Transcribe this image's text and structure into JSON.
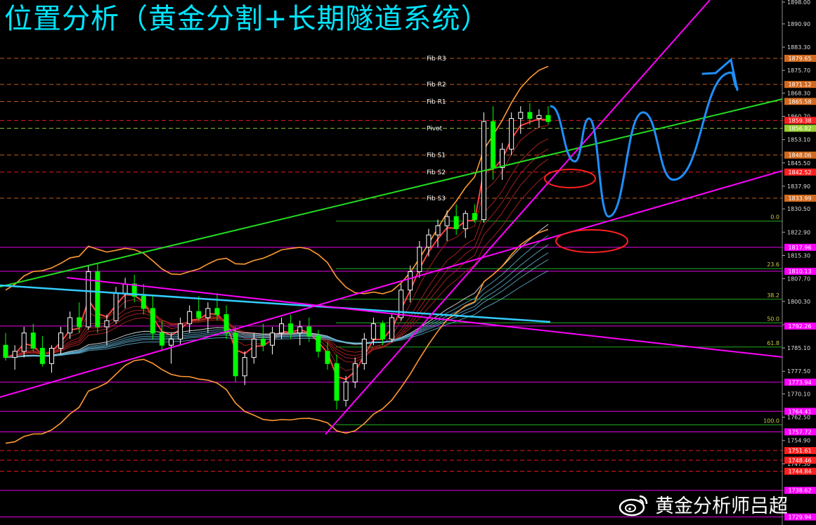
{
  "title": "位置分析（黄金分割+长期隧道系统）",
  "watermark": {
    "logo": "weibo-logo",
    "text": "黄金分析师吕超"
  },
  "colors": {
    "background": "#000000",
    "title": "#00e5ff",
    "magenta": "#ff00ff",
    "green_trend": "#22dd22",
    "cyan_trend": "#33ccff",
    "bollinger": "#ff9933",
    "blue_forecast": "#1e90ff",
    "red_ellipse": "#ff2020",
    "candle_up": "#ffffff",
    "candle_down": "#00ff00"
  },
  "chart_data": {
    "type": "candlestick",
    "instrument_hint": "gold",
    "ylim": [
      1728.0,
      1898.0
    ],
    "price_axis_ticks": [
      "1898.00",
      "1890.90",
      "1883.30",
      "1875.70",
      "1868.30",
      "1860.70",
      "1853.10",
      "1845.50",
      "1837.90",
      "1830.50",
      "1822.90",
      "1815.30",
      "1807.70",
      "1800.30",
      "1792.70",
      "1785.10",
      "1777.50",
      "1770.10",
      "1762.50",
      "1754.90",
      "1747.30"
    ],
    "level_tags": [
      {
        "value": 1879.65,
        "label": "1879.65",
        "color": "#d2691e"
      },
      {
        "value": 1871.12,
        "label": "1871.12",
        "color": "#d2691e"
      },
      {
        "value": 1865.58,
        "label": "1865.58",
        "color": "#d2691e"
      },
      {
        "value": 1859.38,
        "label": "1859.38",
        "color": "#ff2020"
      },
      {
        "value": 1856.82,
        "label": "1856.82",
        "color": "#9acd32"
      },
      {
        "value": 1848.06,
        "label": "1848.06",
        "color": "#d2691e"
      },
      {
        "value": 1842.52,
        "label": "1842.52",
        "color": "#ff2020"
      },
      {
        "value": 1833.99,
        "label": "1833.99",
        "color": "#d2691e"
      },
      {
        "value": 1817.96,
        "label": "1817.96",
        "color": "#ff00ff"
      },
      {
        "value": 1810.13,
        "label": "1810.13",
        "color": "#ff00ff"
      },
      {
        "value": 1792.26,
        "label": "1792.26",
        "color": "#ff00ff"
      },
      {
        "value": 1773.94,
        "label": "1773.94",
        "color": "#ff00ff"
      },
      {
        "value": 1764.41,
        "label": "1764.41",
        "color": "#ff00ff"
      },
      {
        "value": 1757.72,
        "label": "1757.72",
        "color": "#ff00ff"
      },
      {
        "value": 1751.61,
        "label": "1751.61",
        "color": "#ff2020"
      },
      {
        "value": 1748.46,
        "label": "1748.46",
        "color": "#ff2020"
      },
      {
        "value": 1744.84,
        "label": "1744.84",
        "color": "#ff2020"
      },
      {
        "value": 1738.62,
        "label": "1738.62",
        "color": "#ff00ff"
      },
      {
        "value": 1729.94,
        "label": "1729.94",
        "color": "#ff00ff"
      }
    ],
    "pivot_levels": [
      {
        "name": "Fib R3",
        "value": 1879.65
      },
      {
        "name": "Fib R2",
        "value": 1871.12
      },
      {
        "name": "Fib R1",
        "value": 1865.58
      },
      {
        "name": "Pivot",
        "value": 1856.82
      },
      {
        "name": "Fib S1",
        "value": 1848.06
      },
      {
        "name": "Fib S2",
        "value": 1842.52
      },
      {
        "name": "Fib S3",
        "value": 1833.99
      }
    ],
    "fib_retracement": [
      {
        "label": "0.0",
        "value": 1826.5
      },
      {
        "label": "23.6",
        "value": 1811.0
      },
      {
        "label": "38.2",
        "value": 1801.0
      },
      {
        "label": "50.0",
        "value": 1793.3
      },
      {
        "label": "61.8",
        "value": 1785.4
      },
      {
        "label": "100.0",
        "value": 1760.0
      }
    ],
    "ohlc": [
      [
        1786,
        1790,
        1781,
        1782
      ],
      [
        1782,
        1786,
        1778,
        1784
      ],
      [
        1784,
        1792,
        1782,
        1790
      ],
      [
        1790,
        1793,
        1784,
        1785
      ],
      [
        1785,
        1789,
        1779,
        1780
      ],
      [
        1780,
        1786,
        1777,
        1785
      ],
      [
        1785,
        1792,
        1783,
        1790
      ],
      [
        1790,
        1797,
        1788,
        1795
      ],
      [
        1795,
        1800,
        1790,
        1792
      ],
      [
        1792,
        1812,
        1791,
        1810
      ],
      [
        1810,
        1813,
        1790,
        1792
      ],
      [
        1792,
        1796,
        1786,
        1794
      ],
      [
        1794,
        1805,
        1793,
        1803
      ],
      [
        1803,
        1808,
        1798,
        1806
      ],
      [
        1806,
        1809,
        1800,
        1802
      ],
      [
        1802,
        1806,
        1796,
        1798
      ],
      [
        1798,
        1802,
        1788,
        1790
      ],
      [
        1790,
        1794,
        1784,
        1786
      ],
      [
        1786,
        1790,
        1780,
        1788
      ],
      [
        1788,
        1795,
        1786,
        1793
      ],
      [
        1793,
        1799,
        1790,
        1797
      ],
      [
        1797,
        1802,
        1794,
        1795
      ],
      [
        1795,
        1800,
        1790,
        1798
      ],
      [
        1798,
        1803,
        1794,
        1796
      ],
      [
        1796,
        1799,
        1788,
        1790
      ],
      [
        1790,
        1792,
        1774,
        1776
      ],
      [
        1776,
        1784,
        1773,
        1782
      ],
      [
        1782,
        1790,
        1780,
        1788
      ],
      [
        1788,
        1793,
        1784,
        1786
      ],
      [
        1786,
        1792,
        1783,
        1790
      ],
      [
        1790,
        1795,
        1788,
        1793
      ],
      [
        1793,
        1796,
        1788,
        1790
      ],
      [
        1790,
        1794,
        1786,
        1792
      ],
      [
        1792,
        1795,
        1787,
        1789
      ],
      [
        1789,
        1791,
        1782,
        1784
      ],
      [
        1784,
        1787,
        1778,
        1780
      ],
      [
        1780,
        1783,
        1765,
        1768
      ],
      [
        1768,
        1776,
        1766,
        1774
      ],
      [
        1774,
        1782,
        1772,
        1780
      ],
      [
        1780,
        1790,
        1778,
        1788
      ],
      [
        1788,
        1795,
        1786,
        1793
      ],
      [
        1793,
        1794,
        1786,
        1788
      ],
      [
        1788,
        1796,
        1787,
        1795
      ],
      [
        1795,
        1806,
        1794,
        1804
      ],
      [
        1804,
        1812,
        1800,
        1810
      ],
      [
        1810,
        1820,
        1808,
        1818
      ],
      [
        1818,
        1824,
        1815,
        1822
      ],
      [
        1822,
        1827,
        1818,
        1825
      ],
      [
        1825,
        1830,
        1820,
        1828
      ],
      [
        1828,
        1832,
        1822,
        1824
      ],
      [
        1824,
        1830,
        1821,
        1829
      ],
      [
        1829,
        1832,
        1826,
        1827
      ],
      [
        1827,
        1862,
        1826,
        1859
      ],
      [
        1859,
        1864,
        1840,
        1844
      ],
      [
        1844,
        1852,
        1840,
        1850
      ],
      [
        1850,
        1862,
        1848,
        1860
      ],
      [
        1860,
        1864,
        1855,
        1862
      ],
      [
        1862,
        1865,
        1858,
        1860
      ],
      [
        1860,
        1863,
        1857,
        1861
      ],
      [
        1861,
        1864,
        1858,
        1859
      ]
    ],
    "forecast_path": [
      1864,
      1846,
      1860,
      1828,
      1862,
      1840,
      1875,
      1870
    ]
  }
}
